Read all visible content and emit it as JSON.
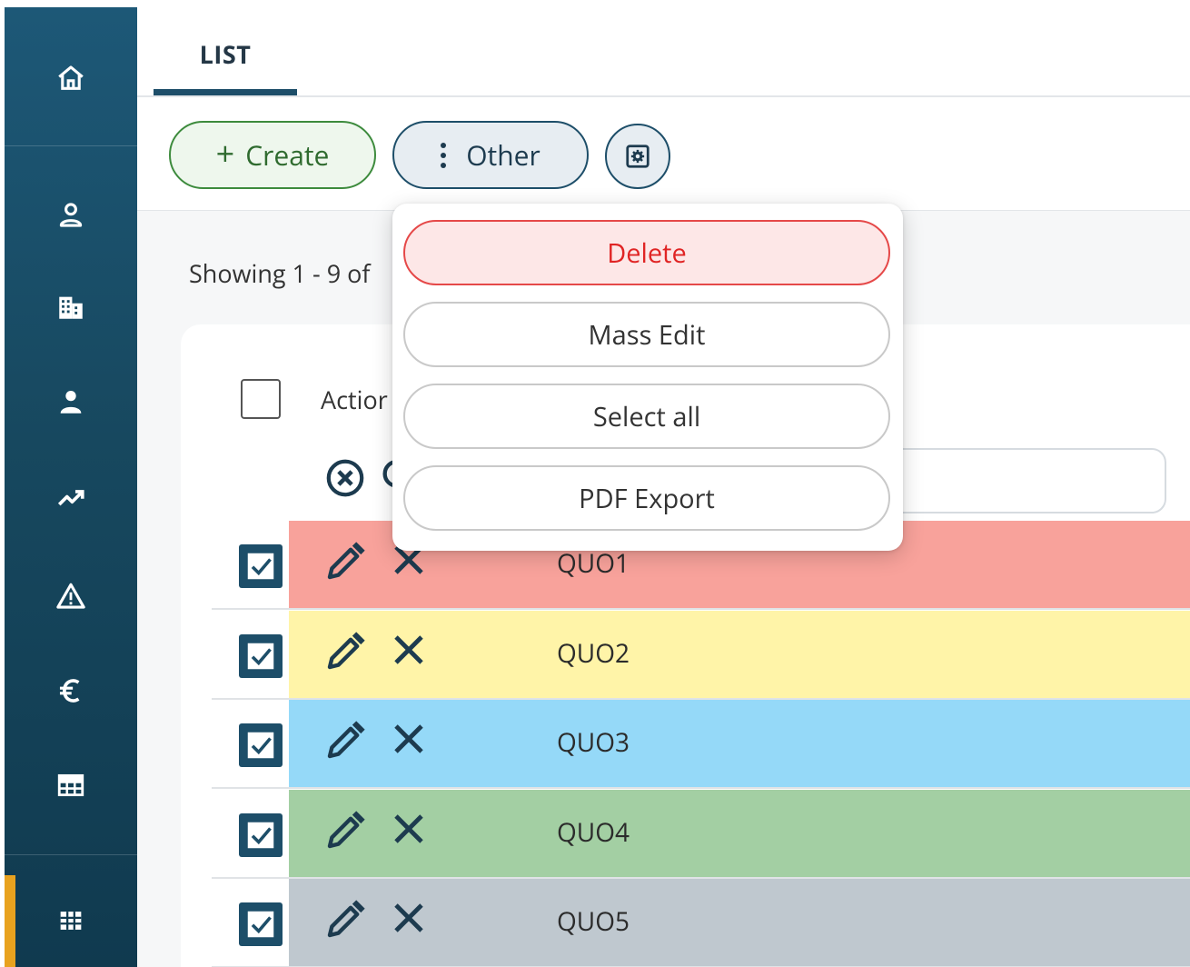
{
  "sidebar": {
    "items": [
      {
        "icon": "home-icon"
      },
      {
        "icon": "user-outline-icon"
      },
      {
        "icon": "building-icon"
      },
      {
        "icon": "person-icon"
      },
      {
        "icon": "trending-up-icon"
      },
      {
        "icon": "warning-icon"
      },
      {
        "icon": "euro-icon"
      },
      {
        "icon": "table-icon"
      },
      {
        "icon": "grid-icon"
      }
    ],
    "active_index": 8,
    "accent_color": "#e8a21f"
  },
  "tabs": [
    {
      "label": "LIST",
      "active": true
    }
  ],
  "toolbar": {
    "create_label": "Create",
    "other_label": "Other",
    "settings_icon": "settings-icon"
  },
  "list": {
    "showing_text": "Showing 1 - 9 of",
    "actions_header": "Actior",
    "rows": [
      {
        "name": "QUO1",
        "color": "#f8a29b",
        "checked": true
      },
      {
        "name": "QUO2",
        "color": "#fff4a8",
        "checked": true
      },
      {
        "name": "QUO3",
        "color": "#95d9f8",
        "checked": true
      },
      {
        "name": "QUO4",
        "color": "#a3cfa3",
        "checked": true
      },
      {
        "name": "QUO5",
        "color": "#bfc8cf",
        "checked": true
      }
    ]
  },
  "dropdown": {
    "items": [
      {
        "label": "Delete",
        "variant": "danger"
      },
      {
        "label": "Mass Edit",
        "variant": "default"
      },
      {
        "label": "Select all",
        "variant": "default"
      },
      {
        "label": "PDF Export",
        "variant": "default"
      }
    ]
  }
}
